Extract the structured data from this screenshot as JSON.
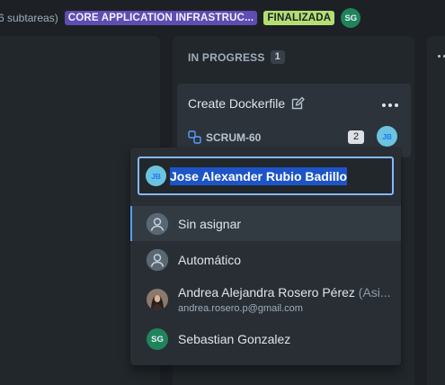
{
  "topbar": {
    "subtasks_text": "6 subtareas)",
    "epic_label": "CORE APPLICATION INFRASTRUC...",
    "status_label": "FINALIZADA",
    "assignee_initials": "SG"
  },
  "columns": {
    "in_progress": {
      "title": "IN PROGRESS",
      "count": "1"
    }
  },
  "card": {
    "title": "Create Dockerfile",
    "key": "SCRUM-60",
    "estimate": "2",
    "assignee_initials": "JB"
  },
  "dropdown": {
    "search_value": "Jose Alexander Rubio Badillo",
    "search_initials": "JB",
    "options": [
      {
        "label": "Sin asignar"
      },
      {
        "label": "Automático"
      },
      {
        "label": "Andrea Alejandra Rosero Pérez",
        "suffix": "(Asi...",
        "email": "andrea.rosero.p@gmail.com"
      },
      {
        "label": "Sebastian Gonzalez",
        "initials": "SG"
      }
    ]
  },
  "colors": {
    "background": "#1d2125",
    "column": "#22272b",
    "card": "#2c333a",
    "epic": "#5e4db2",
    "status_done": "#b3df72",
    "focus": "#85b8ff",
    "selection": "#1d54c7"
  },
  "icons": {
    "edit": "pencil-edit-icon",
    "subtask": "subtask-icon",
    "more": "more-horizontal-icon",
    "unassigned": "person-icon"
  }
}
